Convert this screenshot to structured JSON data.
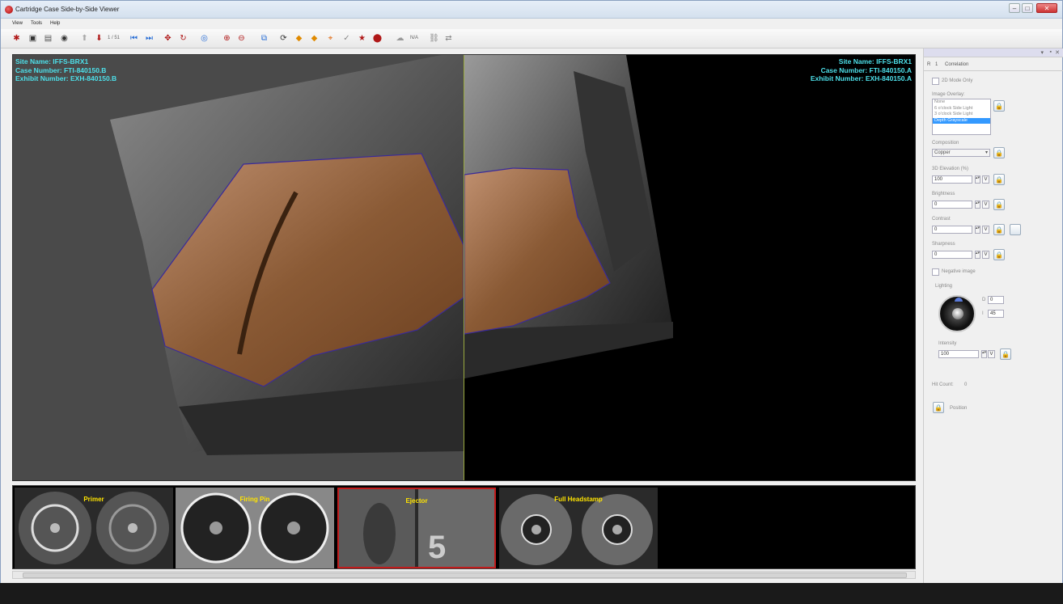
{
  "window": {
    "title": "Cartridge Case Side-by-Side Viewer"
  },
  "menu": [
    "View",
    "Tools",
    "Help"
  ],
  "toolbar": {
    "page_counter": "1 / 51",
    "na_label": "N/A"
  },
  "viewer": {
    "left": {
      "site": "Site Name: IFFS-BRX1",
      "case": "Case Number: FTI-840150.B",
      "exhibit": "Exhibit Number: EXH-840150.B"
    },
    "right": {
      "site": "Site Name: IFFS-BRX1",
      "case": "Case Number: FTI-840150.A",
      "exhibit": "Exhibit Number: EXH-840150.A"
    }
  },
  "thumbnails": [
    {
      "label": "Primer"
    },
    {
      "label": "Firing Pin"
    },
    {
      "label": "Ejector"
    },
    {
      "label": "Full Headstamp"
    }
  ],
  "panel": {
    "tabs": [
      "R",
      "1",
      "Correlation"
    ],
    "mode_2d": "2D Mode Only",
    "image_overlay_label": "Image Overlay:",
    "overlay_options": [
      "None",
      "6 o'clock Side Light",
      "3 o'clock Side Light",
      "Depth Grayscale"
    ],
    "overlay_selected": 3,
    "composition_label": "Composition",
    "composition_value": "Copper",
    "elevation_label": "3D Elevation (%)",
    "elevation_value": "100",
    "brightness_label": "Brightness",
    "brightness_value": "0",
    "contrast_label": "Contrast",
    "contrast_value": "0",
    "sharpness_label": "Sharpness",
    "sharpness_value": "0",
    "negative_label": "Negative image",
    "lighting_label": "Lighting",
    "light_d_label": "D",
    "light_d_value": "0",
    "light_i_label": "I",
    "light_i_value": "45",
    "intensity_label": "Intensity",
    "intensity_value": "100",
    "v_label": "V",
    "hit_count_label": "Hit Count:",
    "hit_count_value": "0",
    "position_label": "Position"
  },
  "colors": {
    "overlay_text": "#4de0ea",
    "thumb_label": "#ffe400",
    "selected_thumb_border": "#c21b1b",
    "divider": "#9aaa40"
  }
}
